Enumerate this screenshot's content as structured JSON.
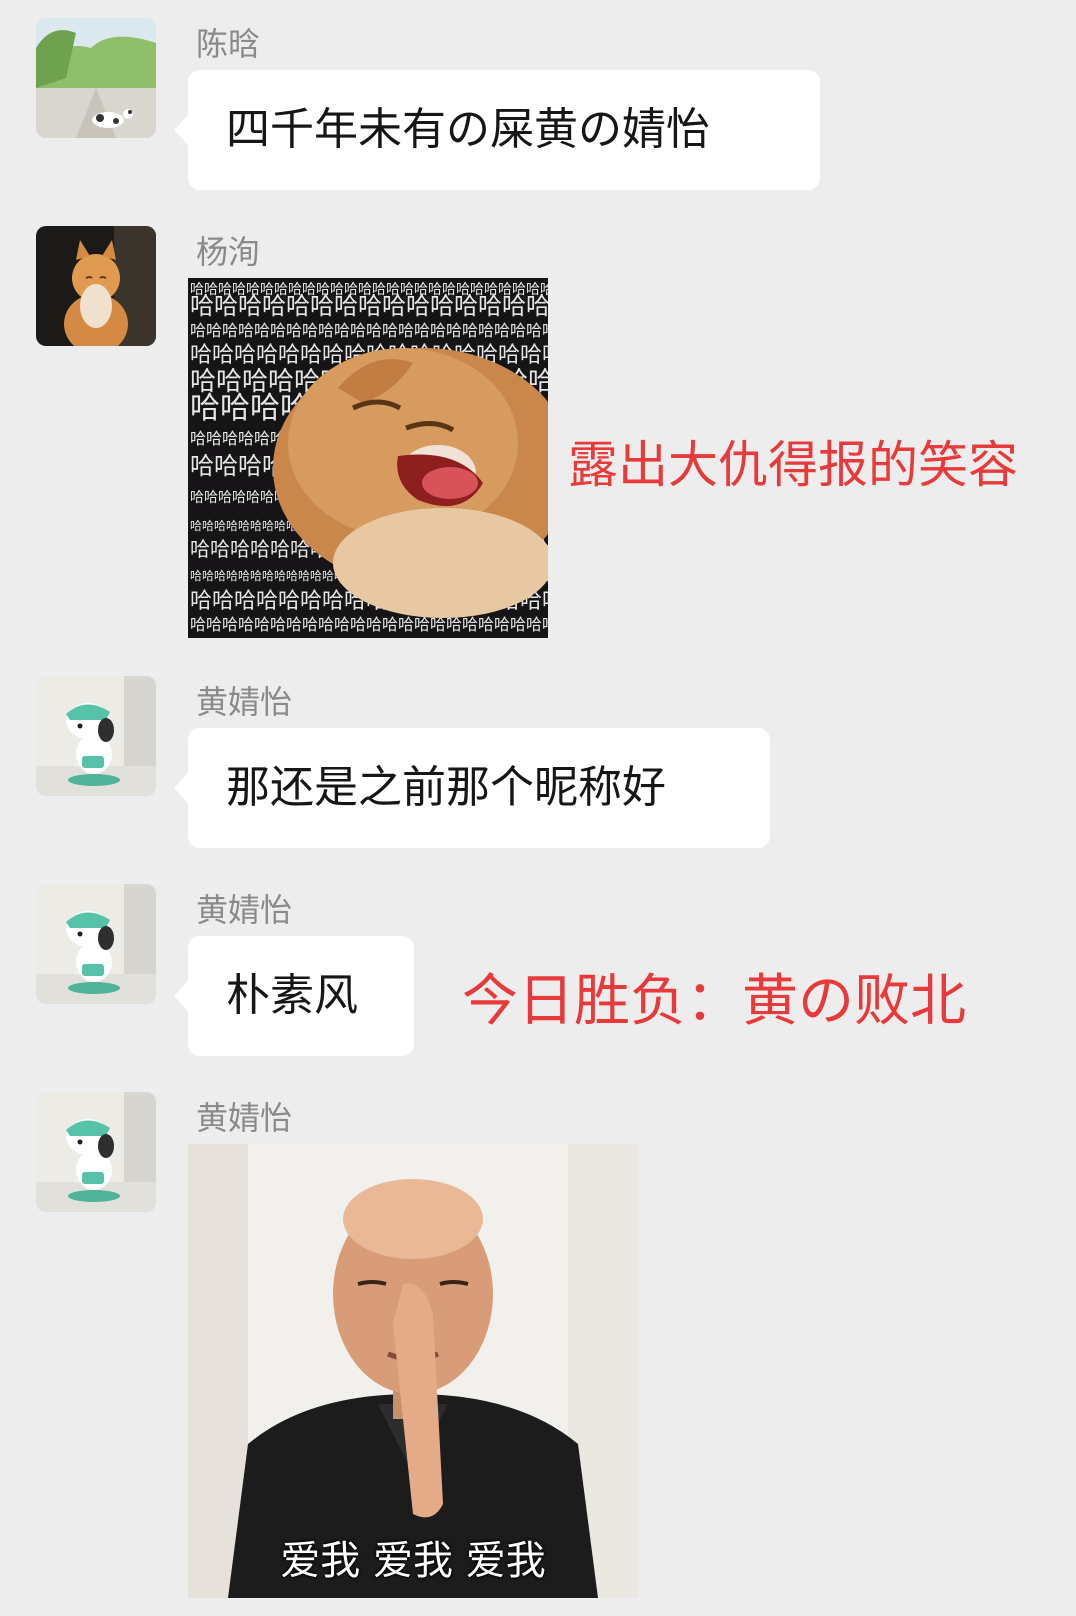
{
  "messages": [
    {
      "sender": "陈晗",
      "avatar_icon": "garden-cat-avatar",
      "type": "text",
      "text": "四千年未有の屎黄の婧怡"
    },
    {
      "sender": "杨洵",
      "avatar_icon": "orange-cat-avatar",
      "type": "sticker",
      "sticker_icon": "laughing-cat-haha-sticker",
      "sticker_text": "哈哈哈哈哈"
    },
    {
      "sender": "黄婧怡",
      "avatar_icon": "pochacco-avatar",
      "type": "text",
      "text": "那还是之前那个昵称好"
    },
    {
      "sender": "黄婧怡",
      "avatar_icon": "pochacco-avatar",
      "type": "text",
      "text": "朴素风"
    },
    {
      "sender": "黄婧怡",
      "avatar_icon": "pochacco-avatar",
      "type": "sticker",
      "sticker_icon": "man-love-me-sticker",
      "caption": "爱我 爱我 爱我"
    }
  ],
  "annotations": [
    {
      "text": "露出大仇得报的笑容",
      "color": "#e83a3a"
    },
    {
      "text": "今日胜负：黄の败北",
      "color": "#e83a3a"
    }
  ]
}
